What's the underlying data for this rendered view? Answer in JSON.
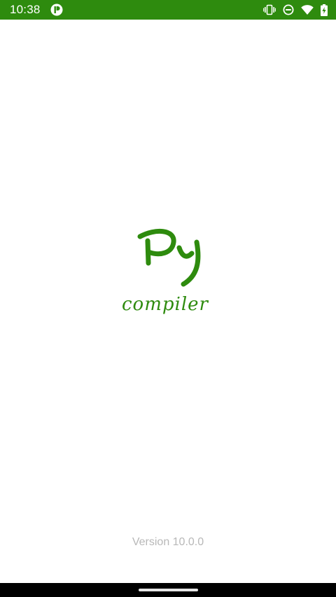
{
  "status_bar": {
    "time": "10:38",
    "background_color": "#2e8b0e",
    "left_icon": "app-notification-icon",
    "right_icons": [
      "vibrate-icon",
      "do-not-disturb-icon",
      "wifi-icon",
      "battery-charging-icon"
    ]
  },
  "splash": {
    "logo_text": "Py",
    "logo_subtitle": "compiler",
    "logo_color": "#2e8b0e",
    "version": "Version 10.0.0"
  },
  "nav_bar": {
    "home_handle_icon": "home-gesture-handle"
  }
}
